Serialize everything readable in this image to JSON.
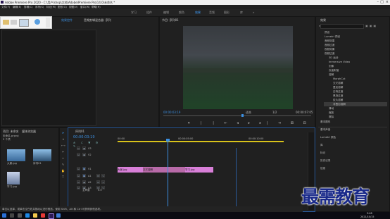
{
  "app_title": "Adobe Premiere Pro 2020 - C:\\用户\\shop\\文档\\Adobe\\Premiere Pro\\14.0\\未命名 *",
  "menu": [
    "文件(F)",
    "编辑(E)",
    "剪辑(C)",
    "序列(S)",
    "标记(M)",
    "图形(G)",
    "视图(V)",
    "窗口(W)",
    "帮助(H)"
  ],
  "workspaces": [
    "学习",
    "组件",
    "编辑",
    "颜色",
    "效果",
    "音频",
    "图形",
    "库",
    "»"
  ],
  "active_workspace": "效果",
  "source_panel": {
    "tabs": [
      "源: (无剪辑)",
      "效果控件",
      "音频剪辑混合器: 序列"
    ]
  },
  "program_monitor": {
    "title": "节目: 序列01",
    "timecode": "00:00:03:19",
    "fit": "适合",
    "ratio": "1/2",
    "duration": "00:00:07:05"
  },
  "project_panel": {
    "tabs": [
      "项目: 未命名",
      "媒体浏览器"
    ],
    "filename": "未命名.prproj",
    "item_count": "3 个项",
    "items": [
      {
        "label": "大景.jpg"
      },
      {
        "label": "序列01"
      },
      {
        "label": "学习.jpg"
      }
    ]
  },
  "timeline": {
    "tab": "序列01",
    "timecode": "00:00:03:19",
    "ruler": [
      "00:00",
      "00:00:05:00",
      "00:00:10:00"
    ],
    "tracks": [
      "V3",
      "V2",
      "V1",
      "A1",
      "A2",
      "A3"
    ],
    "master": "主声道",
    "master_value": "0.0",
    "clips": [
      {
        "label": "大景.jpg"
      },
      {
        "label": "交叉溶解"
      },
      {
        "label": "学习.jpg"
      }
    ]
  },
  "effects_panel": {
    "title": "效果",
    "tree": [
      "预设",
      "Lumetri 预设",
      "音频效果",
      "音频过渡",
      "视频效果",
      "视频过渡",
      "3D 运动",
      "Immersive Video",
      "划像",
      "页面剥落",
      "溶解",
      "MorphCut",
      "交叉溶解",
      "叠加溶解",
      "白场过渡",
      "黑场过渡",
      "胶片溶解",
      "非叠加溶解",
      "滑动",
      "缩放",
      "擦除"
    ],
    "sections": [
      "基本图形",
      "基本声音",
      "Lumetri 颜色",
      "库",
      "标记",
      "历史记录",
      "信息"
    ]
  },
  "watermark": "最需教育",
  "status_bar": "单击以选择，或单击空白处并拖动以进行框选。使用 Shift、Alt 和 Ctrl 可获得其他选项。",
  "taskbar": {
    "time": "9:48",
    "date": "2021/10/15"
  }
}
